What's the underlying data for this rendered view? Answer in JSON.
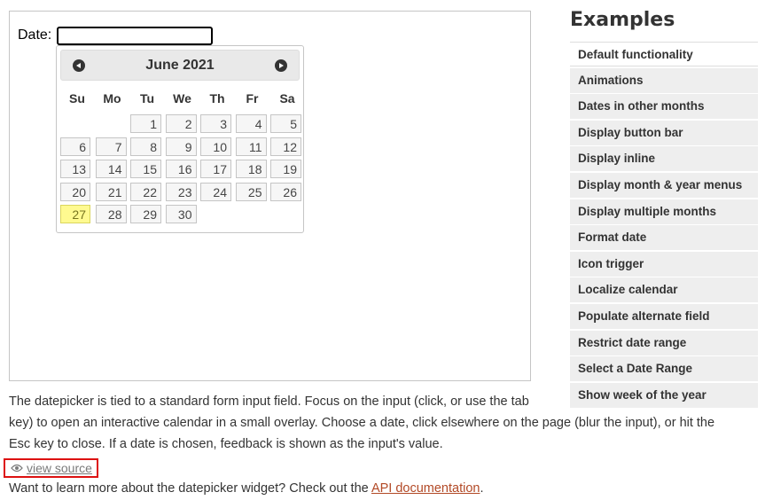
{
  "field": {
    "label": "Date:",
    "value": ""
  },
  "datepicker": {
    "month_year": "June 2021",
    "weekdays": [
      "Su",
      "Mo",
      "Tu",
      "We",
      "Th",
      "Fr",
      "Sa"
    ],
    "weeks": [
      [
        "",
        "",
        "1",
        "2",
        "3",
        "4",
        "5"
      ],
      [
        "6",
        "7",
        "8",
        "9",
        "10",
        "11",
        "12"
      ],
      [
        "13",
        "14",
        "15",
        "16",
        "17",
        "18",
        "19"
      ],
      [
        "20",
        "21",
        "22",
        "23",
        "24",
        "25",
        "26"
      ],
      [
        "27",
        "28",
        "29",
        "30",
        "",
        "",
        ""
      ]
    ],
    "today": "27"
  },
  "examples": {
    "title": "Examples",
    "items": [
      "Default functionality",
      "Animations",
      "Dates in other months",
      "Display button bar",
      "Display inline",
      "Display month & year menus",
      "Display multiple months",
      "Format date",
      "Icon trigger",
      "Localize calendar",
      "Populate alternate field",
      "Restrict date range",
      "Select a Date Range",
      "Show week of the year"
    ],
    "active_index": 0
  },
  "description": {
    "line1": "The datepicker is tied to a standard form input field. Focus on the input (click, or use the tab",
    "line2": "key) to open an interactive calendar in a small overlay. Choose a date, click elsewhere on the page (blur the input), or hit the",
    "line3": "Esc key to close. If a date is chosen, feedback is shown as the input's value."
  },
  "view_source": {
    "label": "view source",
    "icon": "eye-icon"
  },
  "learn_more": {
    "prefix": "Want to learn more about the datepicker widget? Check out the ",
    "link": "API documentation",
    "suffix": "."
  },
  "colors": {
    "today_bg": "#fffa90",
    "link": "#b24926",
    "highlight_border": "#dd1111"
  }
}
